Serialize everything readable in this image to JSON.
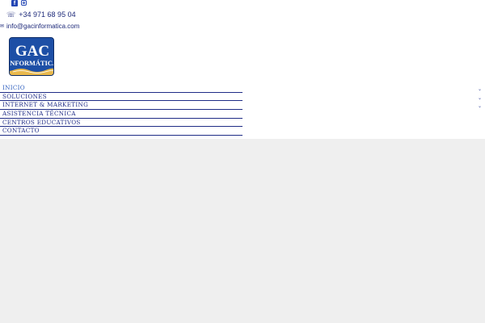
{
  "social": {
    "facebook_icon": "facebook-icon",
    "instagram_icon": "instagram-icon",
    "facebook_glyph": "f"
  },
  "contact": {
    "phone_icon": "☏",
    "phone": "+34 971 68 95 04",
    "email_icon": "✉",
    "email": "info@gacinformatica.com"
  },
  "logo": {
    "line1": "GAC",
    "line2": "INFORMÁTICA"
  },
  "nav": {
    "items": [
      {
        "label": "INICIO",
        "active": true,
        "has_submenu": false
      },
      {
        "label": "SOLUCIONES",
        "active": false,
        "has_submenu": true
      },
      {
        "label": "INTERNET & MARKETING",
        "active": false,
        "has_submenu": true
      },
      {
        "label": "ASISTENCIA TÉCNICA",
        "active": false,
        "has_submenu": true
      },
      {
        "label": "CENTROS EDUCATIVOS",
        "active": false,
        "has_submenu": false
      },
      {
        "label": "CONTACTO",
        "active": false,
        "has_submenu": false
      }
    ],
    "chevron": "⌄"
  },
  "colors": {
    "brand_blue": "#1f2c86",
    "accent_blue": "#2446b4",
    "logo_bg": "#1d4fa6",
    "logo_gold": "#e9b94c",
    "content_bg": "#efefef"
  }
}
